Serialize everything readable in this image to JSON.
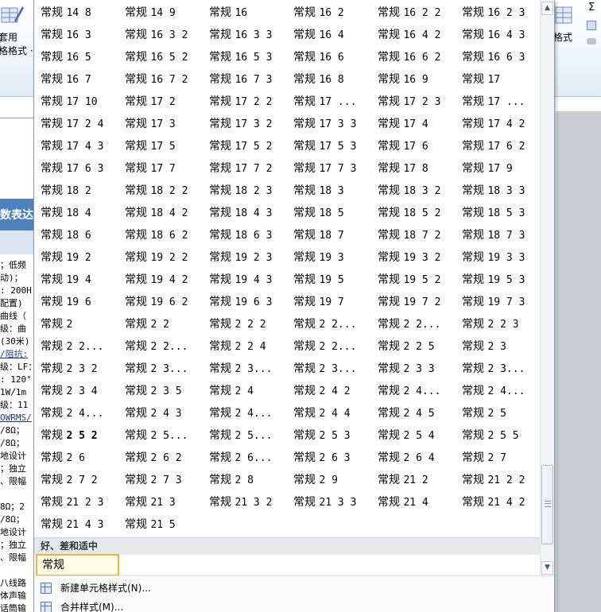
{
  "ribbon_left": {
    "table_format_label_1": "套用",
    "table_format_label_2": "格格式 ·"
  },
  "ribbon_right": {
    "format_label": "格式",
    "sum_glyph": "Σ"
  },
  "sheet_fragment": {
    "header_text": "数表达",
    "lines": [
      "；低频",
      "动)；",
      ": 200H",
      "配置)",
      "曲线（",
      "级：曲",
      "(30米)",
      "/阻抗:",
      "级：LF：",
      ": 120°",
      "1W/1m",
      "级：11",
      "OWRMS/",
      "/8Ω；",
      "/8Ω；",
      "地设计",
      "；独立",
      "、限幅",
      "",
      "8Ω；2",
      "/8Ω；",
      "地设计",
      "；独立",
      "、限幅",
      "",
      "八线路",
      "体声输",
      "话筒输"
    ]
  },
  "gallery": {
    "style_prefix": "常规",
    "columns": 6,
    "tiles": [
      "14 8",
      "14 9",
      "16",
      "16 2",
      "16 2 2",
      "16 2 3",
      "16 3",
      "16 3 2",
      "16 3 3",
      "16 4",
      "16 4 2",
      "16 4 3",
      "16 5",
      "16 5 2",
      "16 5 3",
      "16 6",
      "16 6 2",
      "16 6 3",
      "16 7",
      "16 7 2",
      "16 7 3",
      "16 8",
      "16 9",
      "17",
      "17 10",
      "17 2",
      "17 2 2",
      "17 ...",
      "17 2 3",
      "17 ...",
      "17 2 4",
      "17 3",
      "17 3 2",
      "17 3 3",
      "17 4",
      "17 4 2",
      "17 4 3",
      "17 5",
      "17 5 2",
      "17 5 3",
      "17 6",
      "17 6 2",
      "17 6 3",
      "17 7",
      "17 7 2",
      "17 7 3",
      "17 8",
      "17 9",
      "18 2",
      "18 2 2",
      "18 2 3",
      "18 3",
      "18 3 2",
      "18 3 3",
      "18 4",
      "18 4 2",
      "18 4 3",
      "18 5",
      "18 5 2",
      "18 5 3",
      "18 6",
      "18 6 2",
      "18 6 3",
      "18 7",
      "18 7 2",
      "18 7 3",
      "19 2",
      "19 2 2",
      "19 2 3",
      "19 3",
      "19 3 2",
      "19 3 3",
      "19 4",
      "19 4 2",
      "19 4 3",
      "19 5",
      "19 5 2",
      "19 5 3",
      "19 6",
      "19 6 2",
      "19 6 3",
      "19 7",
      "19 7 2",
      "19 7 3",
      "2",
      "2 2",
      "2 2 2",
      "2 2...",
      "2 2...",
      "2 2 3",
      "2 2...",
      "2 2...",
      "2 2 4",
      "2 2...",
      "2 2 5",
      "2 3",
      "2 3 2",
      "2 3...",
      "2 3...",
      "2 3...",
      "2 3 3",
      "2 3...",
      "2 3 4",
      "2 3 5",
      "2 4",
      "2 4 2",
      "2 4...",
      "2 4...",
      "2 4...",
      "2 4 3",
      "2 4...",
      "2 4 4",
      "2 4 5",
      "2 5",
      "2 5 2",
      "2 5...",
      "2 5...",
      "2 5 3",
      "2 5 4",
      "2 5 5",
      "2 6",
      "2 6 2",
      "2 6...",
      "2 6 3",
      "2 6 4",
      "2 7",
      "2 7 2",
      "2 7 3",
      "2 8",
      "2 9",
      "21 2",
      "21 2 2",
      "21 2 3",
      "21 3",
      "21 3 2",
      "21 3 3",
      "21 4",
      "21 4 2",
      "21 4 3",
      "21 5"
    ],
    "bold_tile_index": 114,
    "section_good_bad_neutral": "好、差和适中",
    "normal_tile_label": "常规"
  },
  "menu": {
    "new_cell_style": "新建单元格样式(N)...",
    "merge_styles": "合并样式(M)..."
  },
  "colors": {
    "selection_border": "#f0b23c",
    "header_blue": "#4f81bd"
  }
}
